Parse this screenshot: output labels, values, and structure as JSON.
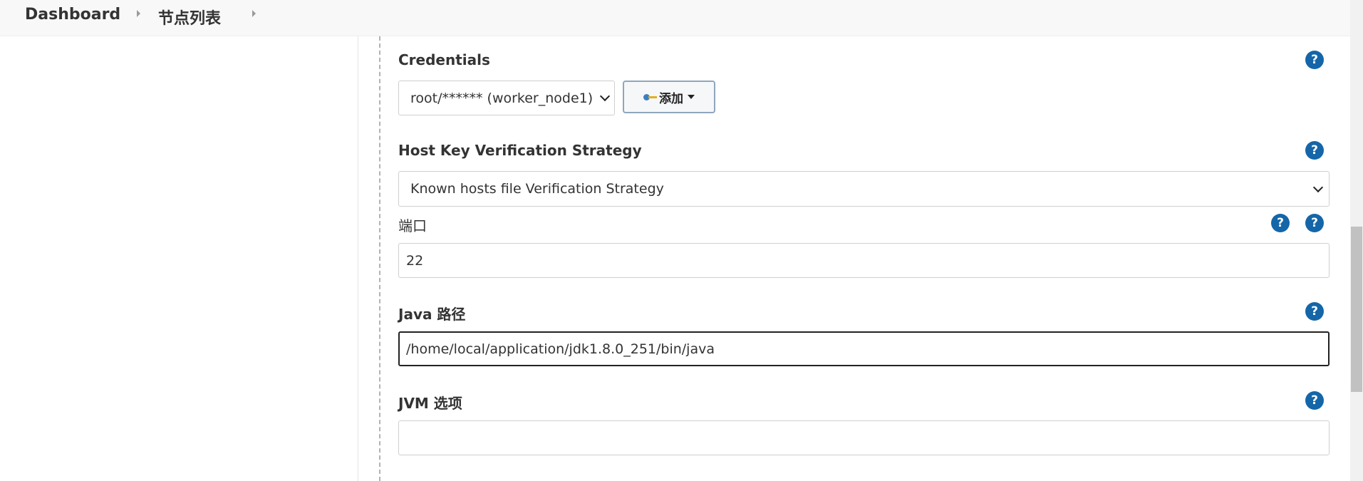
{
  "breadcrumb": {
    "items": [
      "Dashboard",
      "节点列表"
    ]
  },
  "form": {
    "credentials": {
      "label": "Credentials",
      "selected": "root/****** (worker_node1)",
      "add_label": "添加"
    },
    "host_key": {
      "label": "Host Key Verification Strategy",
      "selected": "Known hosts file Verification Strategy"
    },
    "port": {
      "label": "端口",
      "value": "22"
    },
    "java_path": {
      "label": "Java 路径",
      "value": "/home/local/application/jdk1.8.0_251/bin/java"
    },
    "jvm_options": {
      "label": "JVM 选项",
      "value": ""
    }
  },
  "help_glyph": "?",
  "icons": [
    "key-icon",
    "help-icon",
    "chevron-down-icon",
    "caret-down-icon",
    "chevron-right-icon"
  ],
  "colors": {
    "help_icon": "#1466a8",
    "topbar_bg": "#f8f8f8",
    "focused_border": "#222222"
  }
}
